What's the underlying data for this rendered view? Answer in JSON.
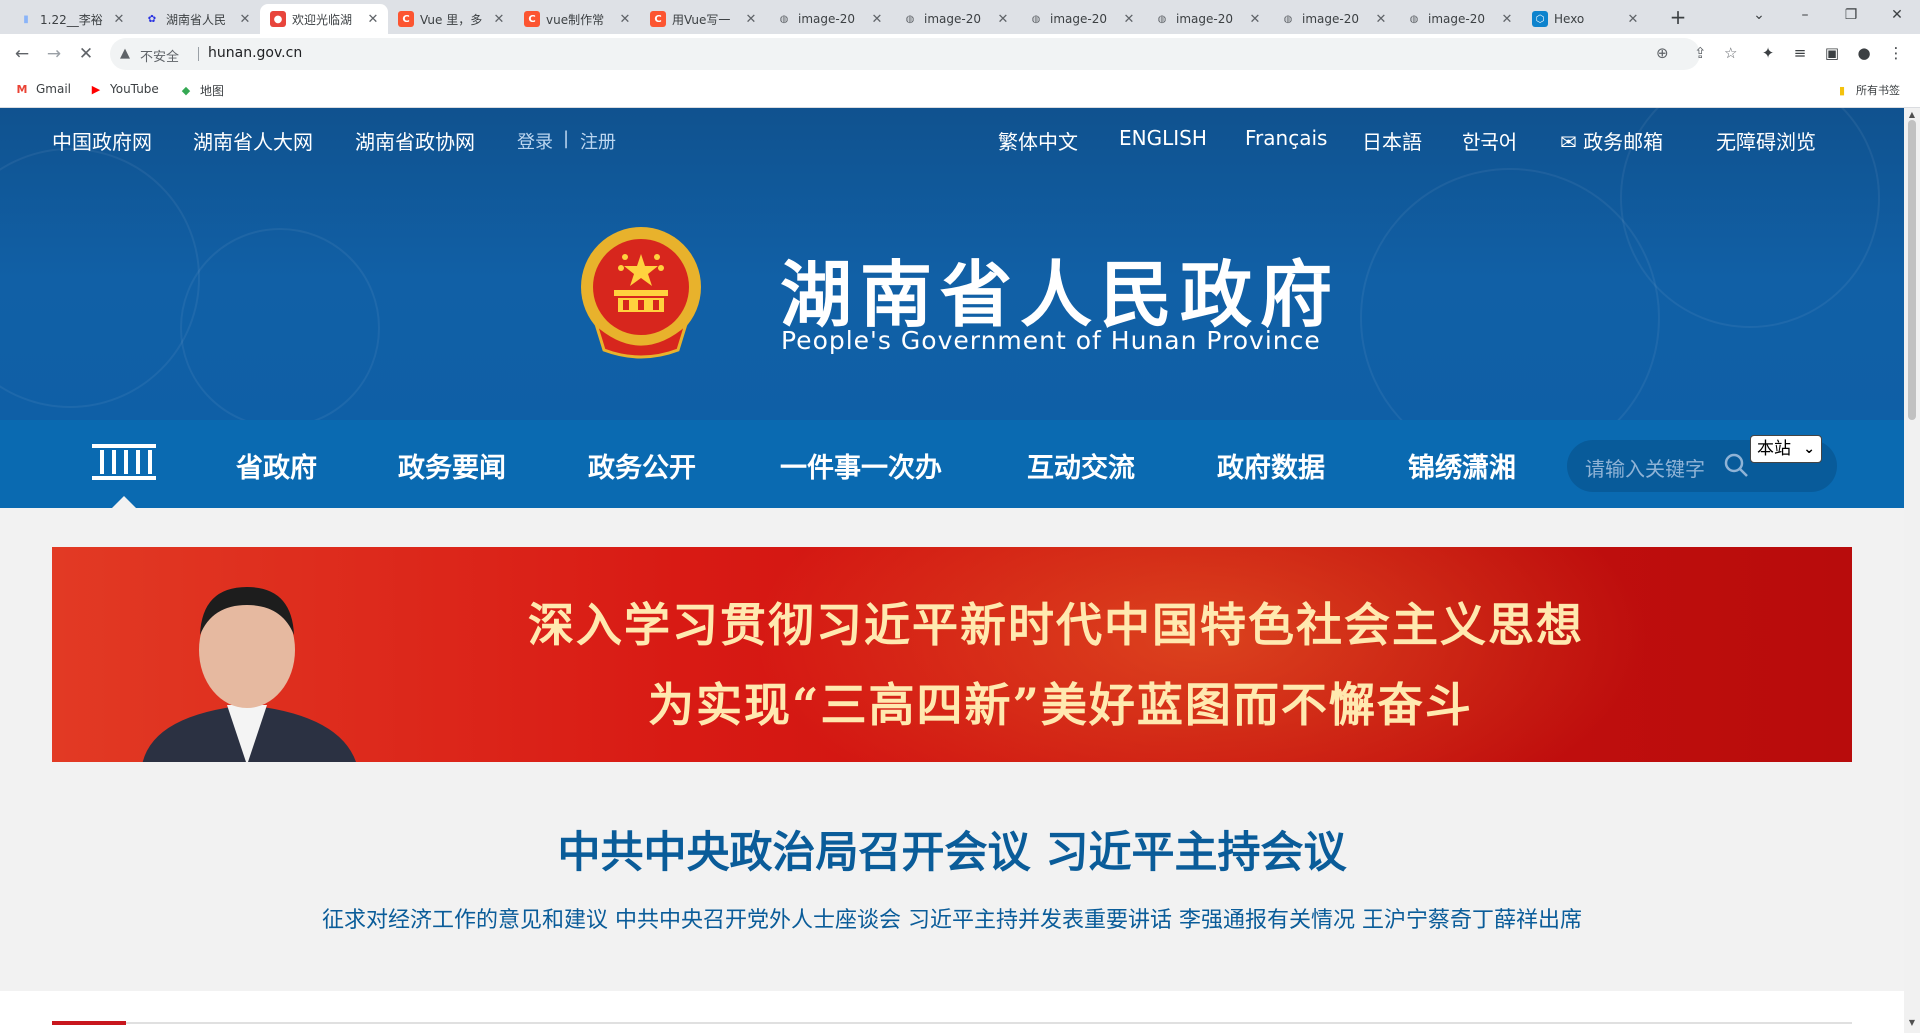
{
  "browser": {
    "tabs": [
      {
        "title": "1.22__李裕",
        "favicon": "doc-icon",
        "color": "#8ab4f8",
        "glyph": "▮"
      },
      {
        "title": "湖南省人民",
        "favicon": "paw-icon",
        "color": "#2932e1",
        "glyph": "✿"
      },
      {
        "title": "欢迎光临湖",
        "favicon": "emblem-icon",
        "color": "#e8453c",
        "glyph": "●",
        "active": true
      },
      {
        "title": "Vue 里，多",
        "favicon": "csdn-icon",
        "color": "#fc5531",
        "glyph": "C"
      },
      {
        "title": "vue制作常",
        "favicon": "csdn-icon",
        "color": "#fc5531",
        "glyph": "C"
      },
      {
        "title": "用Vue写一",
        "favicon": "csdn-icon",
        "color": "#fc5531",
        "glyph": "C"
      },
      {
        "title": "image-20",
        "favicon": "globe-icon",
        "color": "#5f6368",
        "glyph": "◍"
      },
      {
        "title": "image-20",
        "favicon": "globe-icon",
        "color": "#5f6368",
        "glyph": "◍"
      },
      {
        "title": "image-20",
        "favicon": "globe-icon",
        "color": "#5f6368",
        "glyph": "◍"
      },
      {
        "title": "image-20",
        "favicon": "globe-icon",
        "color": "#5f6368",
        "glyph": "◍"
      },
      {
        "title": "image-20",
        "favicon": "globe-icon",
        "color": "#5f6368",
        "glyph": "◍"
      },
      {
        "title": "image-20",
        "favicon": "globe-icon",
        "color": "#5f6368",
        "glyph": "◍"
      },
      {
        "title": "Hexo",
        "favicon": "hexo-icon",
        "color": "#0e83cd",
        "glyph": "⬡"
      }
    ],
    "new_tab": "+",
    "window_controls": {
      "tab_search": "⌄",
      "minimize": "–",
      "restore": "❐",
      "close": "✕"
    },
    "nav": {
      "back": "←",
      "forward": "→",
      "stop": "✕"
    },
    "omnibox": {
      "warning_icon": "▲",
      "security_label": "不安全",
      "url": "hunan.gov.cn"
    },
    "omni_icons": [
      "zoom-icon",
      "share-icon",
      "star-icon"
    ],
    "toolbar_icons": [
      "extensions-icon",
      "media-icon",
      "sidepanel-icon",
      "profile-icon",
      "menu-icon"
    ],
    "bookmarks": [
      {
        "label": "Gmail",
        "icon": "gmail-icon",
        "glyph": "M",
        "color": "#ea4335"
      },
      {
        "label": "YouTube",
        "icon": "youtube-icon",
        "glyph": "▶",
        "color": "#ff0000"
      },
      {
        "label": "地图",
        "icon": "maps-icon",
        "glyph": "◆",
        "color": "#34a853"
      }
    ],
    "all_bookmarks": "所有书签"
  },
  "header": {
    "left_links": [
      "中国政府网",
      "湖南省人大网",
      "湖南省政协网"
    ],
    "login": "登录",
    "divider": "|",
    "register": "注册",
    "right_links": [
      "繁体中文",
      "ENGLISH",
      "Français",
      "日本語",
      "한국어"
    ],
    "mailbox": "政务邮箱",
    "accessibility": "无障碍浏览",
    "title_cn": "湖南省人民政府",
    "title_en": "People's Government of Hunan Province",
    "colors": {
      "header_bg": "#10528f",
      "nav_bg": "#0a6ab1",
      "headline": "#0a5c99"
    }
  },
  "navbar": {
    "items": [
      "省政府",
      "政务要闻",
      "政务公开",
      "一件事一次办",
      "互动交流",
      "政府数据",
      "锦绣潇湘"
    ],
    "search_placeholder": "请输入关键字",
    "site_option": "本站"
  },
  "banner": {
    "line1": "深入学习贯彻习近平新时代中国特色社会主义思想",
    "line2": "为实现“三高四新”美好蓝图而不懈奋斗"
  },
  "news": {
    "headline": "中共中央政治局召开会议 习近平主持会议",
    "subline": "征求对经济工作的意见和建议 中共中央召开党外人士座谈会 习近平主持并发表重要讲话 李强通报有关情况 王沪宁蔡奇丁薛祥出席"
  }
}
